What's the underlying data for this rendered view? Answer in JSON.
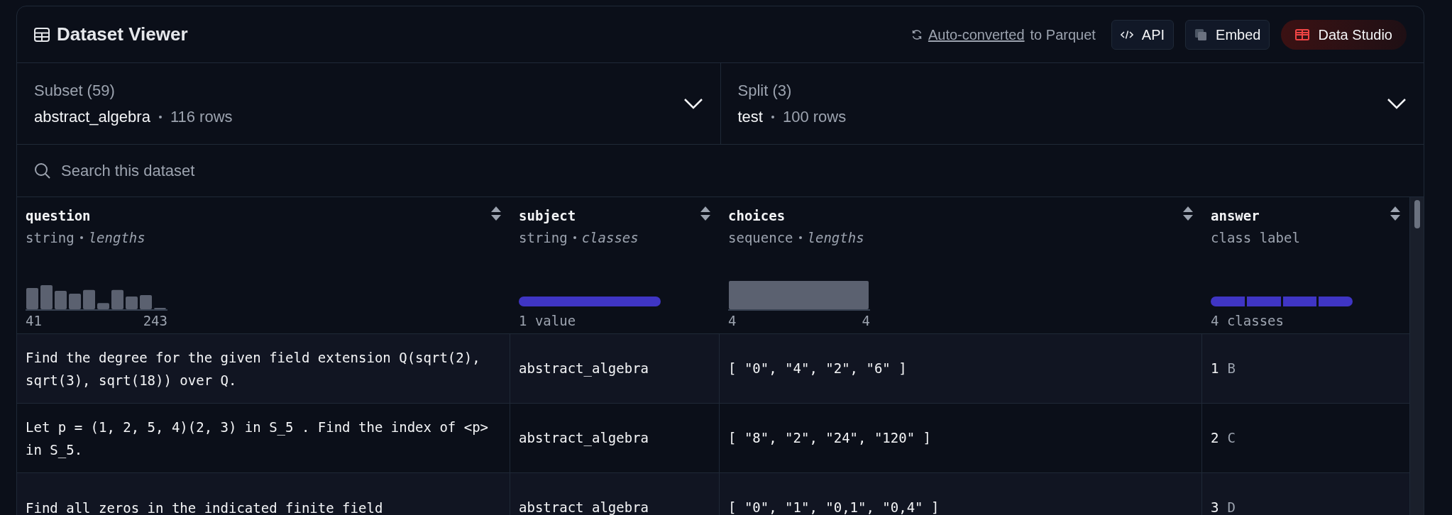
{
  "header": {
    "title": "Dataset Viewer",
    "conversion_link": "Auto-converted",
    "conversion_suffix": "to Parquet",
    "buttons": [
      {
        "label": "API",
        "kind": "api"
      },
      {
        "label": "Embed",
        "kind": "embed"
      },
      {
        "label": "Data Studio",
        "kind": "studio"
      }
    ]
  },
  "selectors": [
    {
      "label": "Subset (59)",
      "value": "abstract_algebra",
      "count": "116 rows"
    },
    {
      "label": "Split (3)",
      "value": "test",
      "count": "100 rows"
    }
  ],
  "search": {
    "placeholder": "Search this dataset"
  },
  "table": {
    "columns": [
      {
        "name": "question",
        "type": "string",
        "stat": "lengths",
        "kind": "histogram",
        "min": "41",
        "max": "243"
      },
      {
        "name": "subject",
        "type": "string",
        "stat": "classes",
        "kind": "classes",
        "summary": "1 value"
      },
      {
        "name": "choices",
        "type": "sequence",
        "stat": "lengths",
        "kind": "histogram",
        "min": "4",
        "max": "4"
      },
      {
        "name": "answer",
        "type": "class label",
        "kind": "classes",
        "summary": "4 classes"
      }
    ],
    "rows": [
      {
        "question": "Find the degree for the given field extension Q(sqrt(2), sqrt(3), sqrt(18)) over Q.",
        "subject": "abstract_algebra",
        "choices": "[ \"0\", \"4\", \"2\", \"6\" ]",
        "answer_index": "1",
        "answer_label": "B"
      },
      {
        "question": "Let p = (1, 2, 5, 4)(2, 3) in S_5 . Find the index of <p> in S_5.",
        "subject": "abstract_algebra",
        "choices": "[ \"8\", \"2\", \"24\", \"120\" ]",
        "answer_index": "2",
        "answer_label": "C"
      },
      {
        "question": "Find all zeros in the indicated finite field",
        "subject": "abstract_algebra",
        "choices": "[ \"0\", \"1\", \"0,1\", \"0,4\" ]",
        "answer_index": "3",
        "answer_label": "D"
      }
    ]
  }
}
